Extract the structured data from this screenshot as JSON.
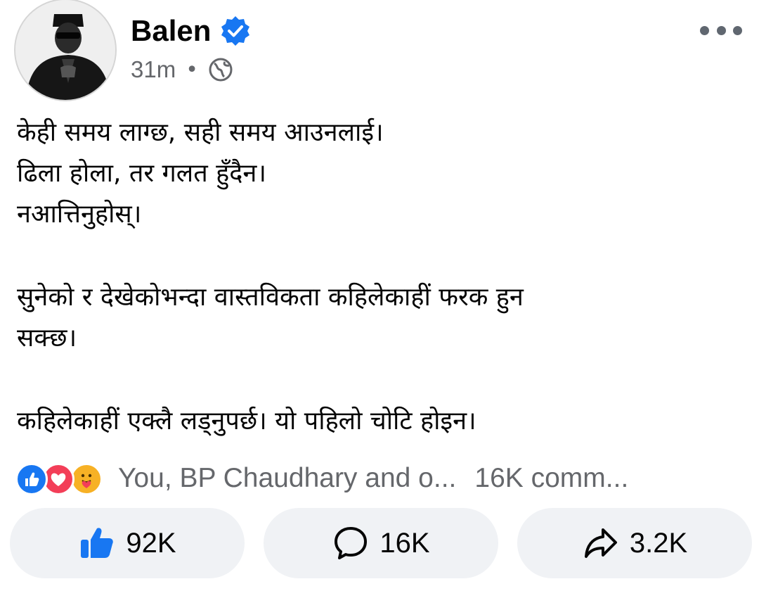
{
  "post": {
    "author": "Balen",
    "time": "31m",
    "dot": "•",
    "lines": [
      "केही समय लाग्छ, सही समय आउनलाई।",
      "ढिला होला, तर गलत हुँदैन।",
      "नआत्तिनुहोस्।",
      "",
      "सुनेको र देखेकोभन्दा वास्तविकता कहिलेकाहीं फरक हुन",
      "सक्छ।",
      "",
      "कहिलेकाहीं एक्लै लड्नुपर्छ। यो पहिलो चोटि होइन।"
    ]
  },
  "reactions": {
    "summary": "You, BP Chaudhary and o...",
    "comments": "16K comm..."
  },
  "actions": {
    "like_count": "92K",
    "comment_count": "16K",
    "share_count": "3.2K"
  },
  "colors": {
    "brand_blue": "#1877f2",
    "love_red": "#f33e58",
    "care_yellow": "#f7b125",
    "secondary_text": "#65676b",
    "button_bg": "#f0f2f5"
  },
  "icons": [
    "avatar",
    "verified-badge-icon",
    "globe-icon",
    "more-options-icon",
    "like-reaction-icon",
    "love-reaction-icon",
    "care-reaction-icon",
    "like-icon",
    "comment-icon",
    "share-icon"
  ]
}
